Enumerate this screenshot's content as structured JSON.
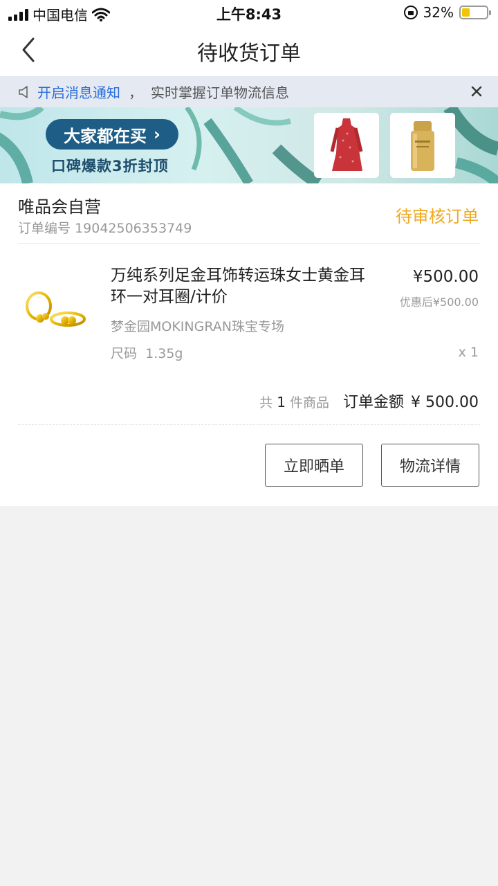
{
  "status_bar": {
    "carrier": "中国电信",
    "time": "上午8:43",
    "battery": "32%",
    "battery_level": 0.32,
    "icons": [
      "signal-icon",
      "wifi-icon",
      "rotation-lock-icon",
      "battery-icon"
    ]
  },
  "nav": {
    "title": "待收货订单",
    "back_icon": "chevron-left-icon"
  },
  "notice": {
    "icon": "speaker-icon",
    "link_text": "开启消息通知",
    "separator": "，",
    "text": "实时掌握订单物流信息",
    "close_icon": "close-icon"
  },
  "banner": {
    "pill_text": "大家都在买",
    "pill_arrow": "›",
    "subtitle": "口碑爆款3折封顶",
    "product_images": [
      "red-dress-image",
      "sunscreen-bottle-image"
    ]
  },
  "order": {
    "shop_name": "唯品会自营",
    "order_number_label": "订单编号",
    "order_number": "19042506353749",
    "status": "待审核订单",
    "product": {
      "image": "gold-earrings-image",
      "title": "万纯系列足金耳饰转运珠女士黄金耳环一对耳圈/计价",
      "store": "梦金园MOKINGRAN珠宝专场",
      "size_label": "尺码",
      "size": "1.35g",
      "price": "¥500.00",
      "discount_price": "优惠后¥500.00",
      "quantity": "x 1"
    },
    "summary": {
      "count_prefix": "共",
      "count": "1",
      "count_suffix": "件商品",
      "total_label": "订单金额",
      "total_amount": "¥ 500.00"
    },
    "buttons": {
      "review": "立即晒单",
      "logistics": "物流详情"
    }
  },
  "colors": {
    "link_blue": "#2a6fdb",
    "status_orange": "#f0a920",
    "notice_bg": "#e4e9f2",
    "banner_pill": "#1e5d86",
    "battery_yellow": "#f4c400"
  }
}
